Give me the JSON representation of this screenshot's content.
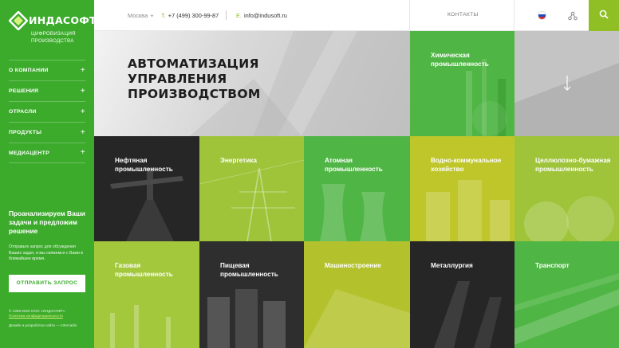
{
  "brand": {
    "name": "ИНДАСОФТ",
    "tagline": "ЦИФРОВИЗАЦИЯ ПРОИЗВОДСТВА",
    "logo_icon": "diamond-logo-icon"
  },
  "sidebar": {
    "nav": [
      {
        "label": "О КОМПАНИИ",
        "icon": "plus-icon"
      },
      {
        "label": "РЕШЕНИЯ",
        "icon": "plus-icon"
      },
      {
        "label": "ОТРАСЛИ",
        "icon": "plus-icon"
      },
      {
        "label": "ПРОДУКТЫ",
        "icon": "plus-icon"
      },
      {
        "label": "МЕДИАЦЕНТР",
        "icon": "plus-icon"
      }
    ],
    "cta_title": "Проанализируем Ваши задачи и предложим решение",
    "cta_text": "Отправьте запрос для обсуждения Ваших задач, и мы свяжемся с Вами в ближайшее время.",
    "cta_button": "ОТПРАВИТЬ ЗАПРОС",
    "copyright": "© 1999-2020 ООО «ИНДАСОФТ».",
    "privacy": "Политика конфиденциальности",
    "designed": "Дизайн и разработка сайта — Intercadio"
  },
  "header": {
    "city": "Москва",
    "city_toggle": "+",
    "phone_label": "T.",
    "phone": "+7 (499) 300-99-87",
    "email_label": "E.",
    "email": "info@indusoft.ru",
    "contacts": "КОНТАКТЫ",
    "language_flag": "russian-flag-icon",
    "network_icon": "network-icon",
    "search_icon": "search-icon"
  },
  "hero": {
    "title_line1": "АВТОМАТИЗАЦИЯ",
    "title_line2": "УПРАВЛЕНИЯ",
    "title_line3": "ПРОИЗВОДСТВОМ"
  },
  "tiles": [
    {
      "label": "Химическая промышленность",
      "color": "#4fb544"
    },
    {
      "label": "",
      "color": "#b9b9b9",
      "icon": "arrow-down-icon"
    },
    {
      "label": "Нефтяная промышленность",
      "color": "#262626"
    },
    {
      "label": "Энергетика",
      "color": "#9fc43a"
    },
    {
      "label": "Атомная промышленность",
      "color": "#4fb544"
    },
    {
      "label": "Водно-коммунальное хозяйство",
      "color": "#bfc62a"
    },
    {
      "label": "Целлюлозно-бумажная промышленность",
      "color": "#9fc43a"
    },
    {
      "label": "Газовая промышленность",
      "color": "#a4c83c"
    },
    {
      "label": "Пищевая промышленность",
      "color": "#2e2e2e"
    },
    {
      "label": "Машиностроение",
      "color": "#b3c22c"
    },
    {
      "label": "Металлургия",
      "color": "#262626"
    },
    {
      "label": "Транспорт",
      "color": "#4fb544"
    }
  ]
}
